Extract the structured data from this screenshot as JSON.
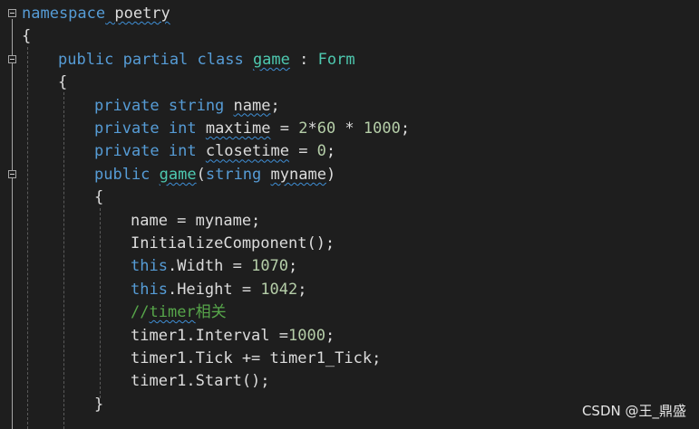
{
  "colors": {
    "background": "#1e1e1e",
    "keyword": "#569cd6",
    "type": "#4ec9b0",
    "number": "#b5cea8",
    "comment": "#57a64a",
    "text": "#dcdcdc"
  },
  "code": {
    "lines": [
      {
        "tokens": [
          {
            "t": "namespace",
            "c": "kw"
          },
          {
            "t": " poetry",
            "c": "squig"
          }
        ]
      },
      {
        "tokens": [
          {
            "t": "{",
            "c": ""
          }
        ]
      },
      {
        "tokens": [
          {
            "t": "public partial class ",
            "c": "kw"
          },
          {
            "t": "game",
            "c": "type squig"
          },
          {
            "t": " : ",
            "c": ""
          },
          {
            "t": "Form",
            "c": "type"
          }
        ]
      },
      {
        "tokens": [
          {
            "t": "{",
            "c": ""
          }
        ]
      },
      {
        "tokens": [
          {
            "t": "private string ",
            "c": "kw"
          },
          {
            "t": "name",
            "c": "squig"
          },
          {
            "t": ";",
            "c": ""
          }
        ]
      },
      {
        "tokens": [
          {
            "t": "private int ",
            "c": "kw"
          },
          {
            "t": "maxtime",
            "c": "squig"
          },
          {
            "t": " = ",
            "c": ""
          },
          {
            "t": "2",
            "c": "num"
          },
          {
            "t": "*",
            "c": ""
          },
          {
            "t": "60",
            "c": "num"
          },
          {
            "t": " * ",
            "c": ""
          },
          {
            "t": "1000",
            "c": "num"
          },
          {
            "t": ";",
            "c": ""
          }
        ]
      },
      {
        "tokens": [
          {
            "t": "private int ",
            "c": "kw"
          },
          {
            "t": "closetime",
            "c": "squig"
          },
          {
            "t": " = ",
            "c": ""
          },
          {
            "t": "0",
            "c": "num"
          },
          {
            "t": ";",
            "c": ""
          }
        ]
      },
      {
        "tokens": [
          {
            "t": "public ",
            "c": "kw"
          },
          {
            "t": "game",
            "c": "type squig"
          },
          {
            "t": "(",
            "c": ""
          },
          {
            "t": "string ",
            "c": "kw"
          },
          {
            "t": "myname",
            "c": "squig"
          },
          {
            "t": ")",
            "c": ""
          }
        ]
      },
      {
        "tokens": [
          {
            "t": "{",
            "c": ""
          }
        ]
      },
      {
        "tokens": [
          {
            "t": "name = myname;",
            "c": ""
          }
        ]
      },
      {
        "tokens": [
          {
            "t": "InitializeComponent();",
            "c": ""
          }
        ]
      },
      {
        "tokens": [
          {
            "t": "this",
            "c": "kw"
          },
          {
            "t": ".Width = ",
            "c": ""
          },
          {
            "t": "1070",
            "c": "num"
          },
          {
            "t": ";",
            "c": ""
          }
        ]
      },
      {
        "tokens": [
          {
            "t": "this",
            "c": "kw"
          },
          {
            "t": ".Height = ",
            "c": ""
          },
          {
            "t": "1042",
            "c": "num"
          },
          {
            "t": ";",
            "c": ""
          }
        ]
      },
      {
        "tokens": [
          {
            "t": "//",
            "c": "cmt"
          },
          {
            "t": "timer",
            "c": "cmt squig"
          },
          {
            "t": "相关",
            "c": "cmt"
          }
        ]
      },
      {
        "tokens": [
          {
            "t": "timer1.Interval =",
            "c": ""
          },
          {
            "t": "1000",
            "c": "num"
          },
          {
            "t": ";",
            "c": ""
          }
        ]
      },
      {
        "tokens": [
          {
            "t": "timer1.Tick += timer1_Tick;",
            "c": ""
          }
        ]
      },
      {
        "tokens": [
          {
            "t": "timer1.Start();",
            "c": ""
          }
        ]
      },
      {
        "tokens": [
          {
            "t": "}",
            "c": ""
          }
        ]
      }
    ]
  },
  "watermark": "CSDN @王_鼎盛"
}
